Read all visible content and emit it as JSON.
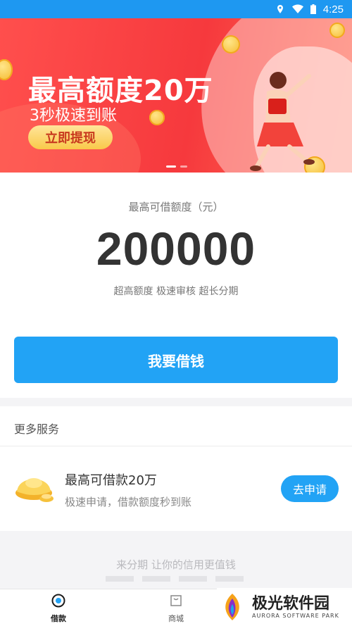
{
  "status_bar": {
    "time": "4:25",
    "icons": [
      "location-icon",
      "wifi-icon",
      "battery-icon"
    ]
  },
  "banner": {
    "title": "最高额度20万",
    "subtitle": "3秒极速到账",
    "button_label": "立即提现",
    "page_count": 2,
    "active_page": 1
  },
  "amount": {
    "label": "最高可借额度（元）",
    "value": "200000",
    "tags": "超高额度 极速审核 超长分期"
  },
  "borrow_button": "我要借钱",
  "services": {
    "title": "更多服务",
    "items": [
      {
        "icon": "gold-ingot-icon",
        "title": "最高可借款20万",
        "desc": "极速申请，借款额度秒到账",
        "action": "去申请"
      }
    ]
  },
  "promo": {
    "text": "来分期  让你的信用更值钱"
  },
  "tabbar": {
    "tabs": [
      {
        "label": "借款",
        "icon": "loan-icon",
        "active": true
      },
      {
        "label": "商城",
        "icon": "shop-icon",
        "active": false
      }
    ]
  },
  "watermark": {
    "name": "极光软件园",
    "subtitle": "AURORA SOFTWARE PARK"
  },
  "colors": {
    "status_bar": "#1e98f1",
    "accent": "#22a3f5",
    "banner": "#f6393d"
  }
}
